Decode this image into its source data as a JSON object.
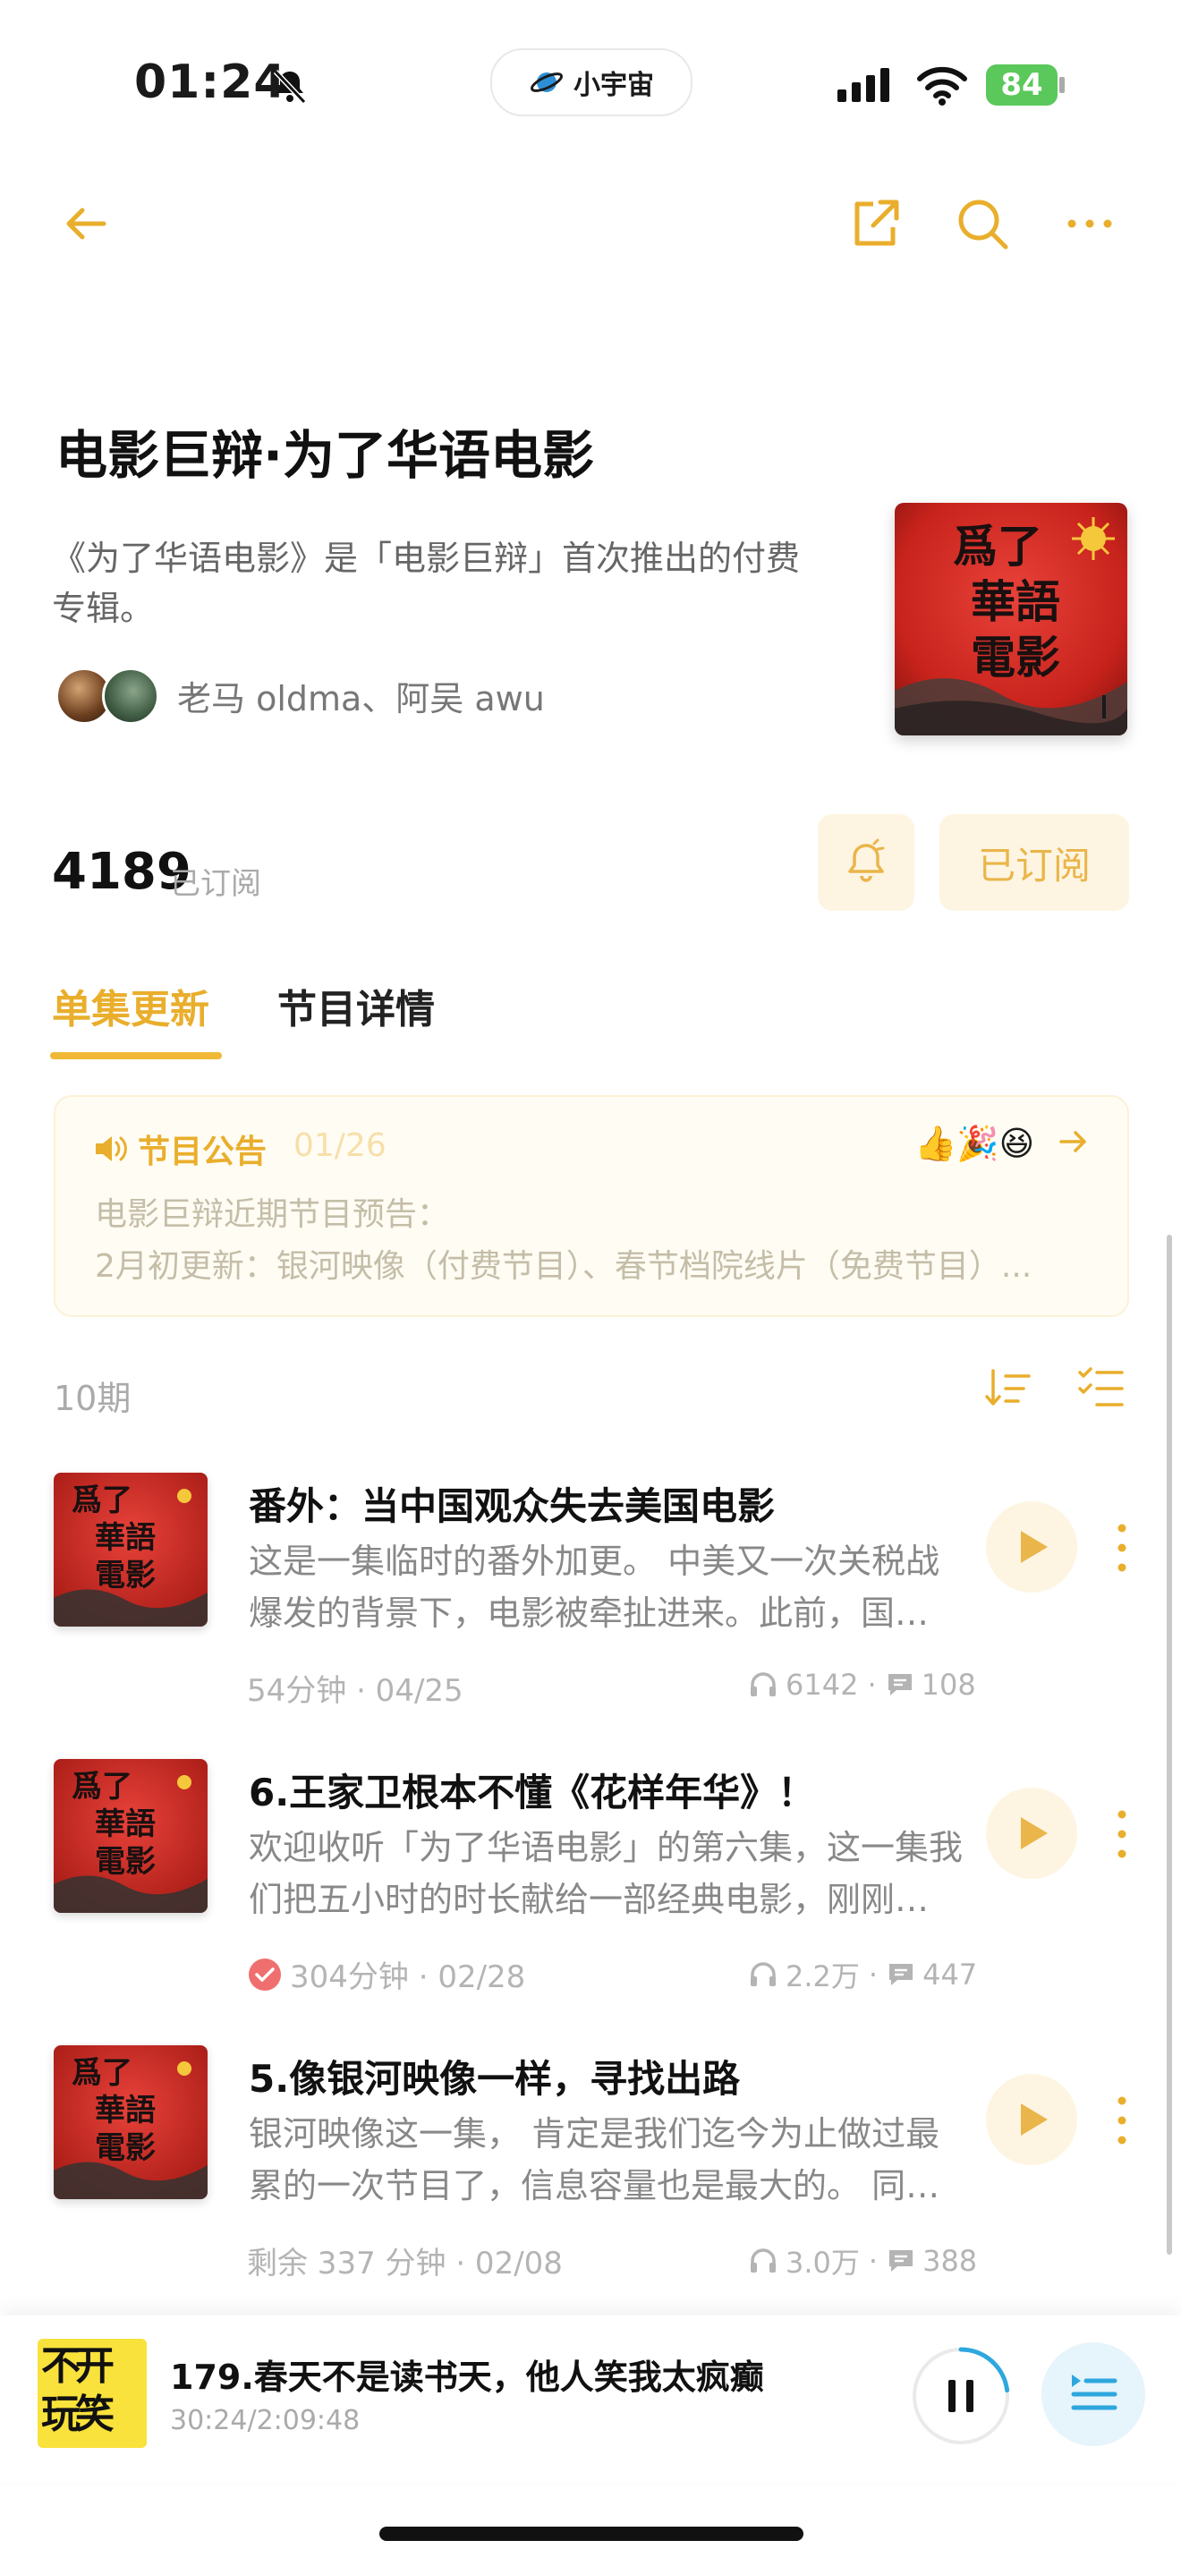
{
  "status_bar": {
    "time": "01:24",
    "app_pill": "小宇宙",
    "battery": "84"
  },
  "header": {
    "icons": [
      "back-arrow-icon",
      "share-icon",
      "search-icon",
      "more-icon"
    ]
  },
  "podcast": {
    "title": "电影巨辩·为了华语电影",
    "description": "《为了华语电影》是「电影巨辩」首次推出的付费专辑。",
    "hosts": "老马 oldma、阿吴 awu",
    "cover_text": [
      "爲了",
      "華語",
      "電影"
    ],
    "subscribers": "4189",
    "subscribers_label": "已订阅",
    "subscribe_button": "已订阅"
  },
  "tabs": [
    {
      "label": "单集更新",
      "active": true
    },
    {
      "label": "节目详情",
      "active": false
    }
  ],
  "notice": {
    "label": "节目公告",
    "date": "01/26",
    "emojis": "👍🎉😆",
    "line1": "电影巨辩近期节目预告：",
    "line2": "2月初更新：银河映像（付费节目）、春节档院线片（免费节目）..."
  },
  "episodes_count": "10期",
  "episodes": [
    {
      "title": "番外：当中国观众失去美国电影",
      "desc1": "这是一集临时的番外加更。 中美又一次关税战",
      "desc2": "爆发的背景下，电影被牵扯进来。此前，国…",
      "meta": "54分钟 · 04/25",
      "plays": "6142",
      "comments": "108",
      "played": false
    },
    {
      "title": "6.王家卫根本不懂《花样年华》！",
      "desc1": "欢迎收听「为了华语电影」的第六集，这一集我",
      "desc2": "们把五小时的时长献给一部经典电影，刚刚…",
      "meta": "304分钟 · 02/28",
      "plays": "2.2万",
      "comments": "447",
      "played": true
    },
    {
      "title": "5.像银河映像一样，寻找出路",
      "desc1": "银河映像这一集， 肯定是我们迄今为止做过最",
      "desc2": "累的一次节目了，信息容量也是最大的。 同…",
      "meta": "剩余 337 分钟 · 02/08",
      "plays": "3.0万",
      "comments": "388",
      "played": false
    }
  ],
  "player": {
    "title": "179.春天不是读书天，他人笑我太疯癫",
    "time": "30:24/2:09:48",
    "cover_text": [
      "不开",
      "玩笑"
    ],
    "progress": 0.23
  },
  "colors": {
    "accent": "#e9ae2c",
    "accent_bg": "#fdf5e2",
    "cover_red": "#c8231c"
  }
}
